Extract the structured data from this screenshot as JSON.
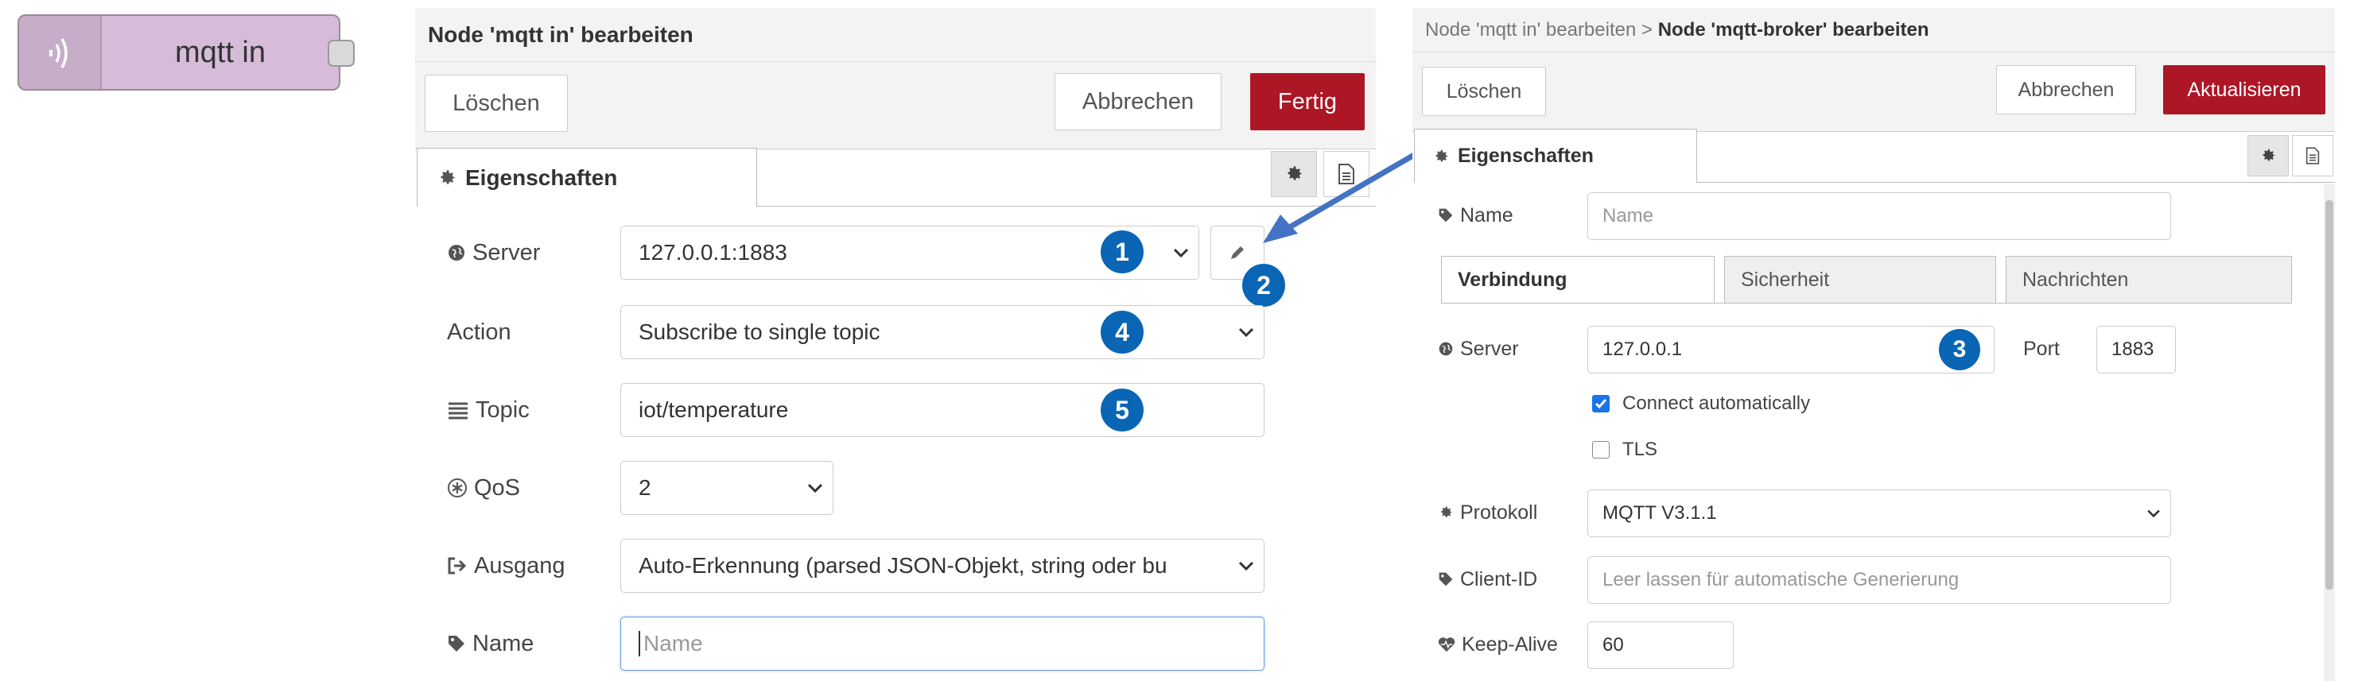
{
  "node": {
    "label": "mqtt in",
    "icon": "bridge-waves-icon",
    "color": "#d7bcd9"
  },
  "editor": {
    "title": "Node 'mqtt in' bearbeiten",
    "delete_label": "Löschen",
    "cancel_label": "Abbrechen",
    "done_label": "Fertig",
    "tab_label": "Eigenschaften",
    "fields": {
      "server": {
        "label": "Server",
        "value": "127.0.0.1:1883",
        "marker": "1"
      },
      "edit_marker": "2",
      "action": {
        "label": "Action",
        "value": "Subscribe to single topic",
        "marker": "4"
      },
      "topic": {
        "label": "Topic",
        "value": "iot/temperature",
        "marker": "5"
      },
      "qos": {
        "label": "QoS",
        "value": "2"
      },
      "output": {
        "label": "Ausgang",
        "value": "Auto-Erkennung (parsed JSON-Objekt, string oder bu"
      },
      "name": {
        "label": "Name",
        "placeholder": "Name"
      }
    }
  },
  "broker": {
    "breadcrumb_parent": "Node 'mqtt in' bearbeiten",
    "breadcrumb_sep": " > ",
    "breadcrumb_current": "Node 'mqtt-broker' bearbeiten",
    "delete_label": "Löschen",
    "cancel_label": "Abbrechen",
    "update_label": "Aktualisieren",
    "tab_label": "Eigenschaften",
    "name": {
      "label": "Name",
      "placeholder": "Name"
    },
    "subtabs": [
      "Verbindung",
      "Sicherheit",
      "Nachrichten"
    ],
    "server": {
      "label": "Server",
      "value": "127.0.0.1",
      "marker": "3"
    },
    "port": {
      "label": "Port",
      "value": "1883"
    },
    "connect_auto": {
      "label": "Connect automatically",
      "checked": true
    },
    "tls": {
      "label": "TLS",
      "checked": false
    },
    "protocol": {
      "label": "Protokoll",
      "value": "MQTT V3.1.1"
    },
    "client_id": {
      "label": "Client-ID",
      "placeholder": "Leer lassen für automatische Generierung"
    },
    "keepalive": {
      "label": "Keep-Alive",
      "value": "60"
    }
  },
  "colors": {
    "primary": "#ad1625",
    "marker": "#0a66b5",
    "arrow": "#4472c4"
  }
}
